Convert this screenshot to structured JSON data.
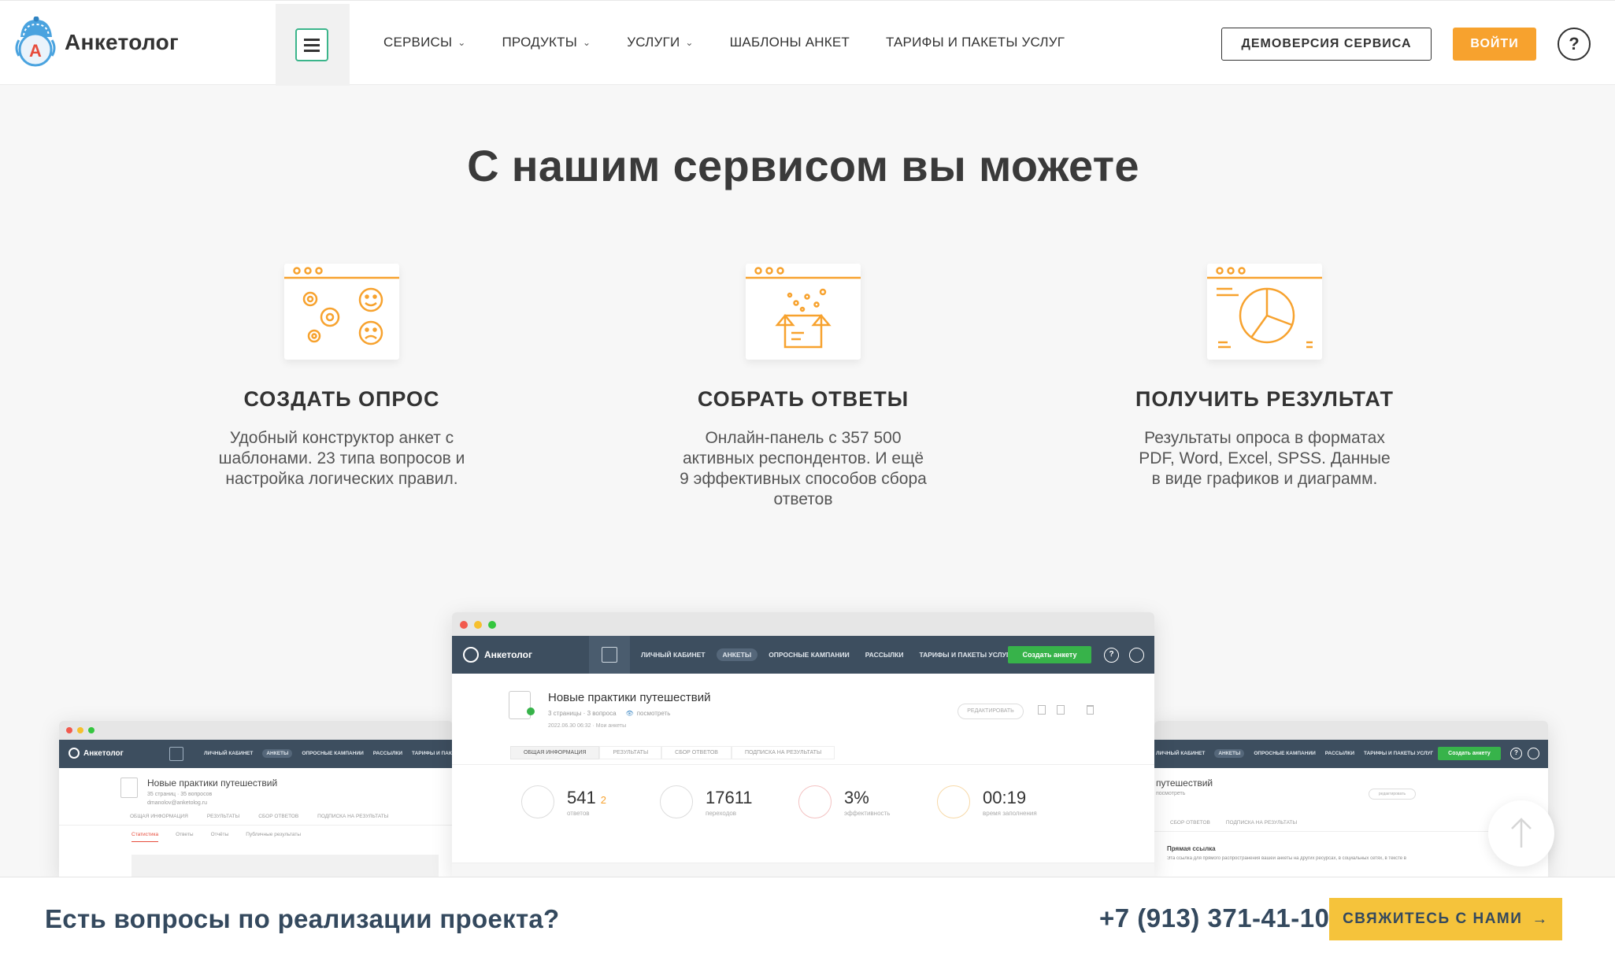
{
  "brand": {
    "name": "Анкетолог"
  },
  "nav": [
    {
      "label": "СЕРВИСЫ",
      "dropdown": true
    },
    {
      "label": "ПРОДУКТЫ",
      "dropdown": true
    },
    {
      "label": "УСЛУГИ",
      "dropdown": true
    },
    {
      "label": "ШАБЛОНЫ АНКЕТ",
      "dropdown": false
    },
    {
      "label": "ТАРИФЫ И ПАКЕТЫ УСЛУГ",
      "dropdown": false
    }
  ],
  "header": {
    "demo_label": "ДЕМОВЕРСИЯ СЕРВИСА",
    "login_label": "ВОЙТИ",
    "help_label": "?"
  },
  "hero": {
    "title": "С нашим сервисом вы можете"
  },
  "features": [
    {
      "icon": "gears-faces-icon",
      "title": "СОЗДАТЬ ОПРОС",
      "text": "Удобный конструктор анкет с шаблонами. 23 типа вопросов и настройка логических правил."
    },
    {
      "icon": "open-box-icon",
      "title": "СОБРАТЬ ОТВЕТЫ",
      "text": "Онлайн-панель с 357 500 активных респондентов. И ещё 9 эффективных способов сбора ответов"
    },
    {
      "icon": "pie-chart-icon",
      "title": "ПОЛУЧИТЬ РЕЗУЛЬТАТ",
      "text": "Результаты опроса в форматах PDF, Word, Excel, SPSS. Данные в виде графиков и диаграмм."
    }
  ],
  "mock_app": {
    "logo": "Анкетолог",
    "nav": [
      "ЛИЧНЫЙ КАБИНЕТ",
      "АНКЕТЫ",
      "ОПРОСНЫЕ КАМПАНИИ",
      "РАССЫЛКИ",
      "ТАРИФЫ И ПАКЕТЫ УСЛУГ"
    ],
    "create_label": "Создать анкету",
    "survey_title": "Новые практики путешествий",
    "survey_meta": "3 страницы · 3 вопроса",
    "survey_view": "посмотреть",
    "survey_date": "2022.06.30 06:32 · Мои анкеты",
    "edit_label": "редактировать",
    "tabs": [
      "ОБЩАЯ ИНФОРМАЦИЯ",
      "РЕЗУЛЬТАТЫ",
      "СБОР ОТВЕТОВ",
      "ПОДПИСКА НА РЕЗУЛЬТАТЫ"
    ],
    "stats": [
      {
        "value": "541",
        "extra": "2",
        "label": "ответов"
      },
      {
        "value": "17611",
        "extra": "",
        "label": "переходов"
      },
      {
        "value": "3%",
        "extra": "",
        "label": "эффективность"
      },
      {
        "value": "00:19",
        "extra": "",
        "label": "время заполнения"
      }
    ],
    "left_survey_meta": "35 страниц · 35 вопросов",
    "left_survey_email": "dmanolov@anketolog.ru",
    "left_tabs": [
      "ОБЩАЯ ИНФОРМАЦИЯ",
      "РЕЗУЛЬТАТЫ",
      "СБОР ОТВЕТОВ",
      "ПОДПИСКА НА РЕЗУЛЬТАТЫ"
    ],
    "left_subtabs": [
      "Статистика",
      "Ответы",
      "Отчёты",
      "Публичные результаты"
    ],
    "right_survey_title": "путешествий",
    "right_tabs": [
      "СБОР ОТВЕТОВ",
      "ПОДПИСКА НА РЕЗУЛЬТАТЫ"
    ],
    "right_link_title": "Прямая ссылка",
    "right_link_text": "Эта ссылка для прямого распространения вашей анкеты на других ресурсах, в социальных сетях, в тексте в"
  },
  "footer": {
    "question": "Есть вопросы по реализации проекта?",
    "phone": "+7 (913) 371-41-10",
    "contact_label": "СВЯЖИТЕСЬ С НАМИ"
  },
  "colors": {
    "accent_orange": "#f7a22e",
    "accent_green": "#3bb58b",
    "contact_yellow": "#f5c33b",
    "dark_text": "#34495e"
  }
}
